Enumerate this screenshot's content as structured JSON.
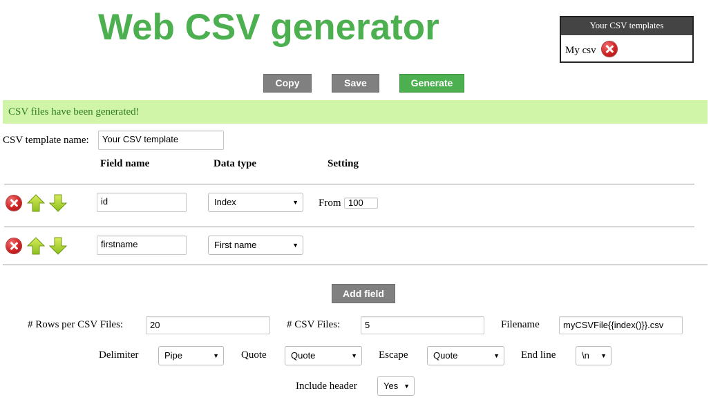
{
  "page_title": "Web CSV generator",
  "templates": {
    "header": "Your CSV templates",
    "items": [
      {
        "name": "My csv"
      }
    ]
  },
  "toolbar": {
    "copy_label": "Copy",
    "save_label": "Save",
    "generate_label": "Generate"
  },
  "alert": "CSV files have been generated!",
  "template_name": {
    "label": "CSV template name:",
    "value": "Your CSV template"
  },
  "columns": {
    "field_name": "Field name",
    "data_type": "Data type",
    "setting": "Setting"
  },
  "fields": [
    {
      "name": "id",
      "type": "Index",
      "setting_label": "From",
      "setting_value": "100"
    },
    {
      "name": "firstname",
      "type": "First name"
    }
  ],
  "add_field_label": "Add field",
  "options": {
    "rows_label": "# Rows per CSV Files:",
    "rows_value": "20",
    "files_label": "# CSV Files:",
    "files_value": "5",
    "filename_label": "Filename",
    "filename_value": "myCSVFile{{index()}}.csv",
    "delimiter_label": "Delimiter",
    "delimiter_value": "Pipe",
    "quote_label": "Quote",
    "quote_value": "Quote",
    "escape_label": "Escape",
    "escape_value": "Quote",
    "endline_label": "End line",
    "endline_value": "\\n",
    "header_label": "Include header",
    "header_value": "Yes"
  },
  "colors": {
    "accent_green": "#4caf50",
    "alert_bg": "#d0f4a8",
    "button_gray": "#808080"
  }
}
